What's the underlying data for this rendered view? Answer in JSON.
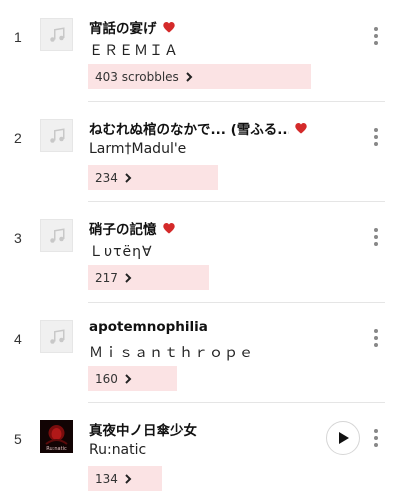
{
  "tracks": [
    {
      "rank": "1",
      "title": "宵話の宴げ",
      "artist": "ＥＲＥＭＩＡ",
      "scrobbles": "403 scrobbles",
      "loved": true,
      "scrobble_fraction": 1.0
    },
    {
      "rank": "2",
      "title": "ねむれぬ棺のなかで... (雪ふる...",
      "artist": "Larm†Madul'e",
      "scrobbles": "234",
      "loved": true,
      "scrobble_fraction": 0.58
    },
    {
      "rank": "3",
      "title": "硝子の記憶",
      "artist": "Ｌυτëη∀",
      "scrobbles": "217",
      "loved": true,
      "scrobble_fraction": 0.54
    },
    {
      "rank": "4",
      "title": "apotemnophilia",
      "artist": "Ｍｉｓａｎｔｈｒｏｐｅ",
      "scrobbles": "160",
      "loved": false,
      "scrobble_fraction": 0.4
    },
    {
      "rank": "5",
      "title": "真夜中ノ日傘少女",
      "artist": "Ru:natic",
      "scrobbles": "134",
      "loved": false,
      "scrobble_fraction": 0.33,
      "cover_text": "Ru:natic"
    }
  ],
  "colors": {
    "heart": "#d42a2a",
    "bar": "#fbe3e4"
  },
  "icons": {
    "placeholder_art": "music-note-icon",
    "more": "more-vertical-icon",
    "play": "play-icon",
    "chevron": "chevron-right-icon",
    "loved": "heart-icon"
  }
}
